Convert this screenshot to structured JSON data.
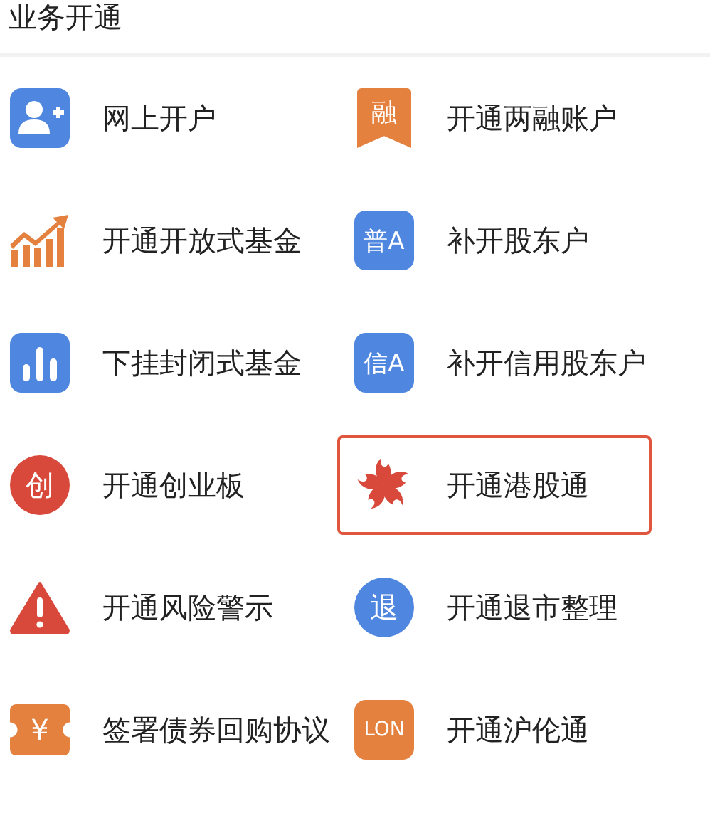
{
  "section": {
    "title": "业务开通"
  },
  "items": [
    {
      "label": "网上开户",
      "kind": "person-add",
      "color": "#4f86e0",
      "selected": false
    },
    {
      "label": "开通两融账户",
      "kind": "ribbon",
      "glyph": "融",
      "color": "#e5813f",
      "selected": false
    },
    {
      "label": "开通开放式基金",
      "kind": "growth-chart",
      "color": "#e5813f",
      "selected": false
    },
    {
      "label": "补开股东户",
      "kind": "square",
      "glyph": "普A",
      "color": "#4f86e0",
      "selected": false
    },
    {
      "label": "下挂封闭式基金",
      "kind": "bar-chart",
      "color": "#4f86e0",
      "selected": false
    },
    {
      "label": "补开信用股东户",
      "kind": "square",
      "glyph": "信A",
      "color": "#4f86e0",
      "selected": false
    },
    {
      "label": "开通创业板",
      "kind": "circle",
      "glyph": "创",
      "color": "#d9493b",
      "selected": false
    },
    {
      "label": "开通港股通",
      "kind": "flower",
      "color": "#d9493b",
      "selected": true
    },
    {
      "label": "开通风险警示",
      "kind": "warning",
      "color": "#d9493b",
      "selected": false
    },
    {
      "label": "开通退市整理",
      "kind": "circle",
      "glyph": "退",
      "color": "#4f86e0",
      "selected": false
    },
    {
      "label": "签署债券回购协议",
      "kind": "ticket",
      "glyph": "¥",
      "color": "#e5813f",
      "selected": false
    },
    {
      "label": "开通沪伦通",
      "kind": "square",
      "glyph": "LON",
      "color": "#e5813f",
      "selected": false
    }
  ]
}
